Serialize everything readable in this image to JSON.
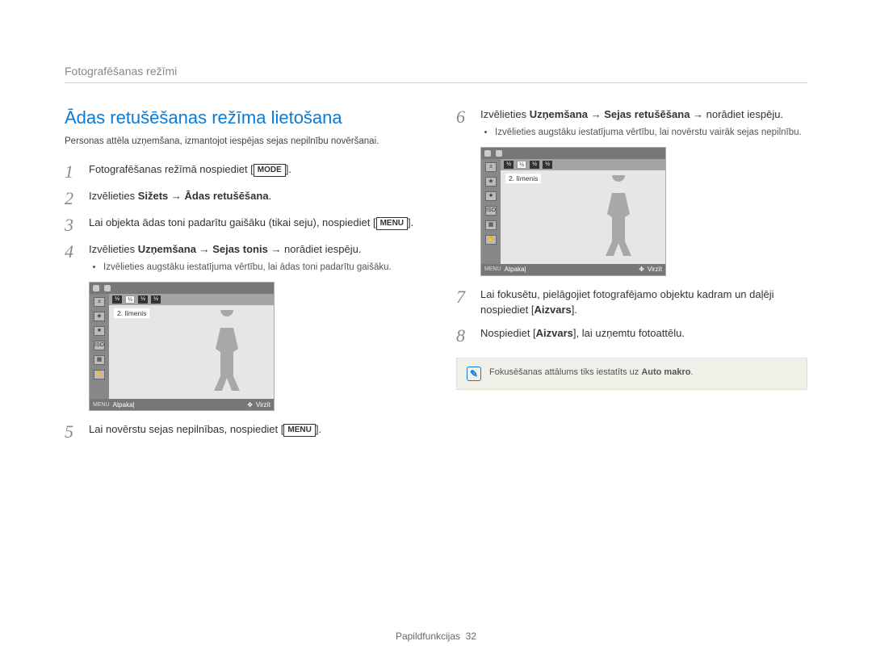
{
  "breadcrumb": "Fotografēšanas režīmi",
  "title": "Ādas retušēšanas režīma lietošana",
  "intro": "Personas attēla uzņemšana, izmantojot iespējas sejas nepilnību novēršanai.",
  "buttons": {
    "mode": "MODE",
    "menu": "MENU"
  },
  "steps_left": {
    "s1": {
      "num": "1",
      "prefix": "Fotografēšanas režīmā nospiediet [",
      "suffix": "]."
    },
    "s2": {
      "num": "2",
      "text": "Izvēlieties ",
      "b1": "Sižets",
      "arrow": " → ",
      "b2": "Ādas retušēšana",
      "end": "."
    },
    "s3": {
      "num": "3",
      "l1": "Lai objekta ādas toni padarītu gaišāku (tikai seju), nospiediet [",
      "l2": "]."
    },
    "s4": {
      "num": "4",
      "prefix": "Izvēlieties ",
      "b1": "Uzņemšana",
      "arr": " → ",
      "b2": "Sejas tonis",
      "suffix": " → norādiet iespēju.",
      "bullet": "Izvēlieties augstāku iestatījuma vērtību, lai ādas toni padarītu gaišāku."
    },
    "s5": {
      "num": "5",
      "prefix": "Lai novērstu sejas nepilnības, nospiediet [",
      "suffix": "]."
    }
  },
  "steps_right": {
    "s6": {
      "num": "6",
      "prefix": "Izvēlieties ",
      "b1": "Uzņemšana",
      "arr": " → ",
      "b2": "Sejas retušēšana",
      "suffix": " → norādiet iespēju.",
      "bullet": "Izvēlieties augstāku iestatījuma vērtību, lai novērstu vairāk sejas nepilnību."
    },
    "s7": {
      "num": "7",
      "l1": "Lai fokusētu, pielāgojiet fotografējamo objektu kadram un daļēji nospiediet [",
      "b": "Aizvars",
      "l2": "]."
    },
    "s8": {
      "num": "8",
      "l1": "Nospiediet [",
      "b": "Aizvars",
      "l2": "], lai uzņemtu fotoattēlu."
    }
  },
  "camera_ui": {
    "level_label": "2. līmenis",
    "back_label": "Atpakaļ",
    "move_label": "Virzīt",
    "menu_small": "MENU"
  },
  "info": {
    "prefix": "Fokusēšanas attālums tiks iestatīts uz ",
    "bold": "Auto makro",
    "suffix": "."
  },
  "footer": {
    "section": "Papildfunkcijas",
    "page": "32"
  }
}
